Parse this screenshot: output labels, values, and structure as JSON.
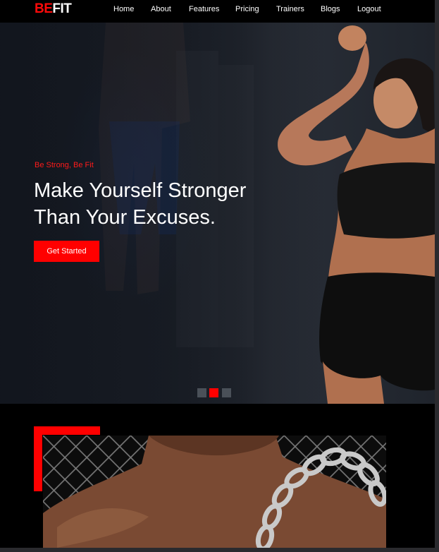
{
  "brand": {
    "logo_part1": "BE",
    "logo_part2": "FIT"
  },
  "nav": {
    "items": [
      {
        "label": "Home"
      },
      {
        "label": "About"
      },
      {
        "label": "Features"
      },
      {
        "label": "Pricing"
      },
      {
        "label": "Trainers"
      },
      {
        "label": "Blogs"
      },
      {
        "label": "Logout"
      }
    ]
  },
  "hero": {
    "tagline": "Be Strong, Be Fit",
    "headline_line1": "Make Yourself Stronger",
    "headline_line2": "Than Your Excuses.",
    "cta_label": "Get Started",
    "slides_total": 3,
    "active_slide": 2
  },
  "colors": {
    "accent": "#ff0000",
    "background": "#000000",
    "text": "#ffffff",
    "dot_inactive": "#4a5058"
  },
  "icons": {
    "hero_image": "fitness-woman-flexing-photo",
    "about_image": "man-with-chain-photo"
  }
}
